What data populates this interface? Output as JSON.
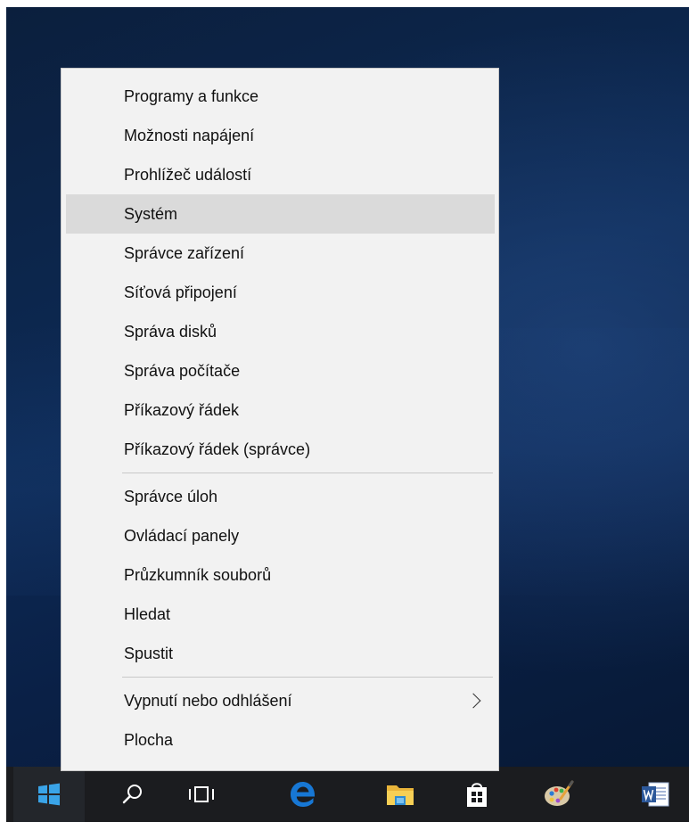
{
  "menu": {
    "group1": [
      {
        "label": "Programy a funkce"
      },
      {
        "label": "Možnosti napájení"
      },
      {
        "label": "Prohlížeč událostí"
      },
      {
        "label": "Systém",
        "highlighted": true
      },
      {
        "label": "Správce zařízení"
      },
      {
        "label": "Síťová připojení"
      },
      {
        "label": "Správa disků"
      },
      {
        "label": "Správa počítače"
      },
      {
        "label": "Příkazový řádek"
      },
      {
        "label": "Příkazový řádek (správce)"
      }
    ],
    "group2": [
      {
        "label": "Správce úloh"
      },
      {
        "label": "Ovládací panely"
      },
      {
        "label": "Průzkumník souborů"
      },
      {
        "label": "Hledat"
      },
      {
        "label": "Spustit"
      }
    ],
    "group3": [
      {
        "label": "Vypnutí nebo odhlášení",
        "submenu": true
      },
      {
        "label": "Plocha"
      }
    ]
  },
  "taskbar": {
    "icons": [
      "windows-start-icon",
      "search-icon",
      "task-view-icon",
      "edge-icon",
      "file-explorer-icon",
      "store-icon",
      "paint-icon",
      "word-icon"
    ]
  },
  "colors": {
    "menu_bg": "#f2f2f2",
    "menu_highlight": "#dadada",
    "taskbar_bg": "#1b1c1f",
    "desktop_bg": "#0d2a55",
    "windows_blue": "#3aa4e8",
    "edge_blue": "#1777d4"
  }
}
